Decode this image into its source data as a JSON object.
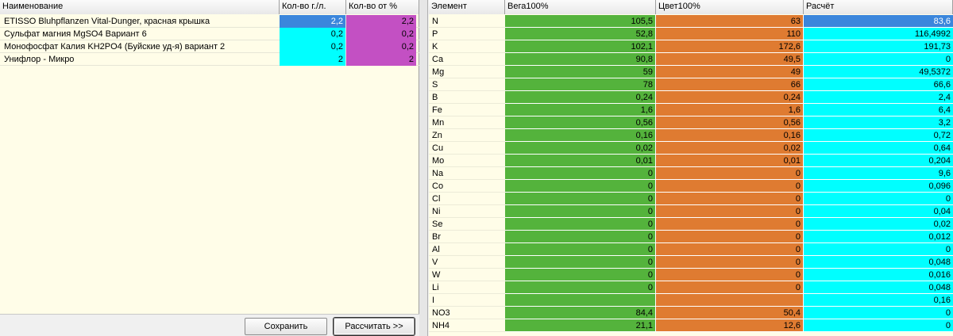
{
  "colors": {
    "green": "#54b33c",
    "orange": "#df7b31",
    "cyan": "#00ffff",
    "magenta": "#c350c3",
    "selected_blue": "#3b86dc",
    "row_bg": "#fffde8"
  },
  "left_table": {
    "headers": {
      "name": "Наименование",
      "gl": "Кол-во г./л.",
      "pct": "Кол-во от %"
    },
    "rows": [
      {
        "name": "ETISSO Bluhpflanzen Vital-Dunger, красная крышка",
        "gl": "2,2",
        "pct": "2,2"
      },
      {
        "name": "Сульфат магния MgSO4 Вариант 6",
        "gl": "0,2",
        "pct": "0,2"
      },
      {
        "name": "Монофосфат Калия KH2PO4 (Буйские уд-я) вариант 2",
        "gl": "0,2",
        "pct": "0,2"
      },
      {
        "name": "Унифлор - Микро",
        "gl": "2",
        "pct": "2"
      }
    ]
  },
  "buttons": {
    "save": "Сохранить",
    "calculate": "Рассчитать >>"
  },
  "right_table": {
    "headers": {
      "element": "Элемент",
      "vega": "Вега100%",
      "cvet": "Цвет100%",
      "calc": "Расчёт"
    },
    "rows": [
      {
        "el": "N",
        "vega": "105,5",
        "cvet": "63",
        "calc": "83,6"
      },
      {
        "el": "P",
        "vega": "52,8",
        "cvet": "110",
        "calc": "116,4992"
      },
      {
        "el": "K",
        "vega": "102,1",
        "cvet": "172,6",
        "calc": "191,73"
      },
      {
        "el": "Ca",
        "vega": "90,8",
        "cvet": "49,5",
        "calc": "0"
      },
      {
        "el": "Mg",
        "vega": "59",
        "cvet": "49",
        "calc": "49,5372"
      },
      {
        "el": "S",
        "vega": "78",
        "cvet": "66",
        "calc": "66,6"
      },
      {
        "el": "B",
        "vega": "0,24",
        "cvet": "0,24",
        "calc": "2,4"
      },
      {
        "el": "Fe",
        "vega": "1,6",
        "cvet": "1,6",
        "calc": "6,4"
      },
      {
        "el": "Mn",
        "vega": "0,56",
        "cvet": "0,56",
        "calc": "3,2"
      },
      {
        "el": "Zn",
        "vega": "0,16",
        "cvet": "0,16",
        "calc": "0,72"
      },
      {
        "el": "Cu",
        "vega": "0,02",
        "cvet": "0,02",
        "calc": "0,64"
      },
      {
        "el": "Mo",
        "vega": "0,01",
        "cvet": "0,01",
        "calc": "0,204"
      },
      {
        "el": "Na",
        "vega": "0",
        "cvet": "0",
        "calc": "9,6"
      },
      {
        "el": "Co",
        "vega": "0",
        "cvet": "0",
        "calc": "0,096"
      },
      {
        "el": "Cl",
        "vega": "0",
        "cvet": "0",
        "calc": "0"
      },
      {
        "el": "Ni",
        "vega": "0",
        "cvet": "0",
        "calc": "0,04"
      },
      {
        "el": "Se",
        "vega": "0",
        "cvet": "0",
        "calc": "0,02"
      },
      {
        "el": "Br",
        "vega": "0",
        "cvet": "0",
        "calc": "0,012"
      },
      {
        "el": "Al",
        "vega": "0",
        "cvet": "0",
        "calc": "0"
      },
      {
        "el": "V",
        "vega": "0",
        "cvet": "0",
        "calc": "0,048"
      },
      {
        "el": "W",
        "vega": "0",
        "cvet": "0",
        "calc": "0,016"
      },
      {
        "el": "Li",
        "vega": "0",
        "cvet": "0",
        "calc": "0,048"
      },
      {
        "el": "I",
        "vega": "",
        "cvet": "",
        "calc": "0,16"
      },
      {
        "el": "NO3",
        "vega": "84,4",
        "cvet": "50,4",
        "calc": "0"
      },
      {
        "el": "NH4",
        "vega": "21,1",
        "cvet": "12,6",
        "calc": "0"
      }
    ]
  }
}
